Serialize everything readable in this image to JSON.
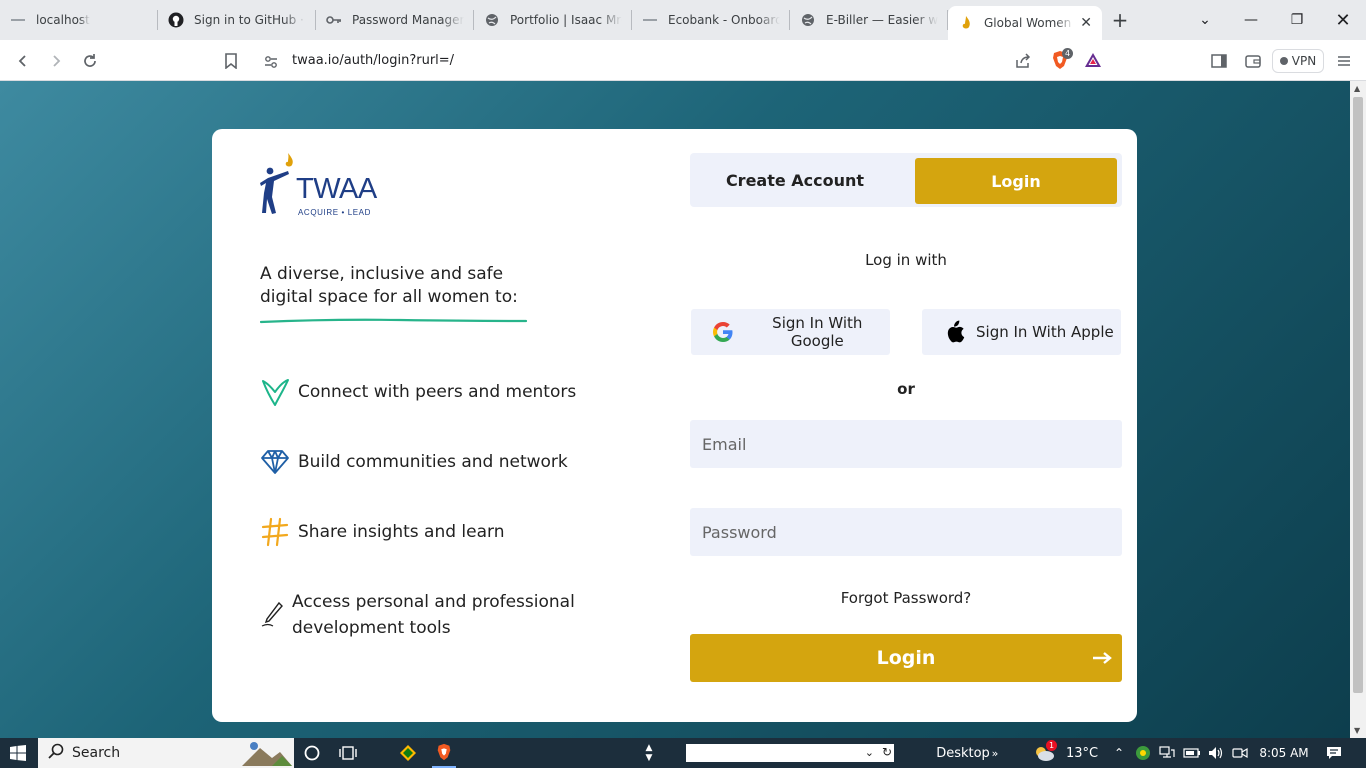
{
  "browser": {
    "tabs": [
      {
        "label": "localhost",
        "icon": "dash-icon"
      },
      {
        "label": "Sign in to GitHub · GitHub",
        "icon": "github-icon"
      },
      {
        "label": "Password Manager",
        "icon": "key-icon"
      },
      {
        "label": "Portfolio | Isaac Mronzi",
        "icon": "globe-icon"
      },
      {
        "label": "Ecobank - Onboarding",
        "icon": "dash-icon"
      },
      {
        "label": "E-Biller — Easier way",
        "icon": "globe-icon"
      },
      {
        "label": "Global Women N",
        "icon": "flame-icon",
        "active": true
      }
    ],
    "url": "twaa.io/auth/login?rurl=/",
    "brave_badge": "4",
    "vpn_label": "VPN"
  },
  "brand": {
    "name": "TWAA",
    "tagline": "ACQUIRE • LEAD",
    "primary_color": "#d4a50f",
    "brand_blue": "#1f3e86"
  },
  "intro": {
    "headline": "A diverse, inclusive and safe digital space for all women to:",
    "features": [
      {
        "icon": "heart-icon",
        "label": "Connect with peers and mentors"
      },
      {
        "icon": "diamond-icon",
        "label": "Build communities and network"
      },
      {
        "icon": "hashtag-icon",
        "label": "Share insights and learn"
      },
      {
        "icon": "pen-icon",
        "label": "Access personal and professional development tools"
      }
    ]
  },
  "auth": {
    "tab_create": "Create Account",
    "tab_login": "Login",
    "login_with": "Log in with",
    "google": "Sign In With Google",
    "apple": "Sign In With Apple",
    "or": "or",
    "email_placeholder": "Email",
    "password_placeholder": "Password",
    "forgot": "Forgot Password?",
    "submit": "Login"
  },
  "taskbar": {
    "search": "Search",
    "desktop": "Desktop",
    "temp": "13°C",
    "time": "8:05 AM",
    "weather_badge": "1"
  }
}
